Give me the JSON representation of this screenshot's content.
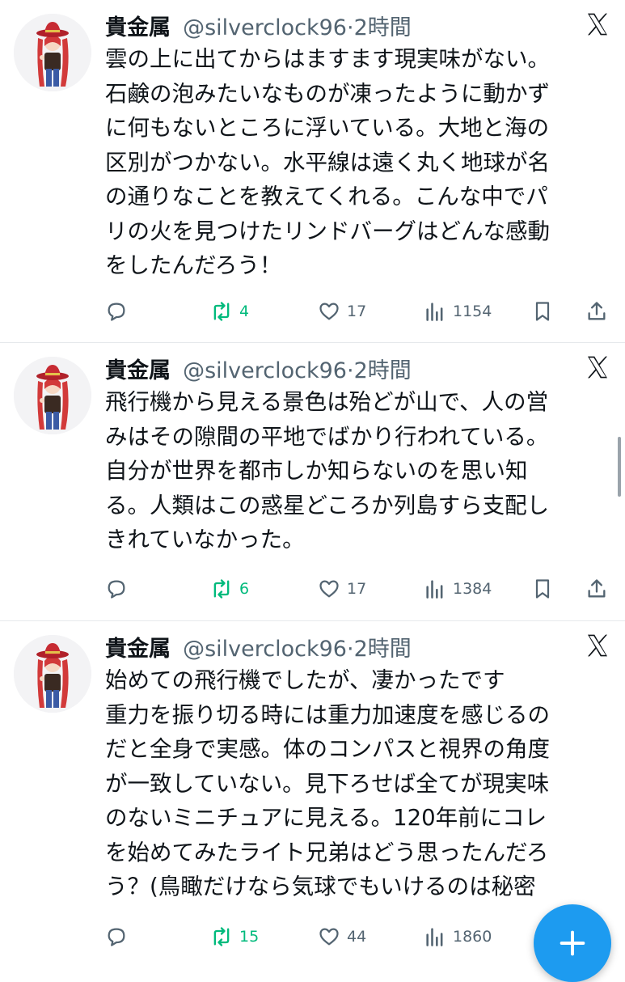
{
  "tweets": [
    {
      "author": "貴金属",
      "handle": "@silverclock96",
      "separator": "·",
      "time": "2時間",
      "lines": [
        "雲の上に出てからはますます現実味がない。",
        "石鹸の泡みたいなものが凍ったように動かず",
        "に何もないところに浮いている。大地と海の",
        "区別がつかない。水平線は遠く丸く地球が名",
        "の通りなことを教えてくれる。こんな中でパ",
        "リの火を見つけたリンドバーグはどんな感動",
        "をしたんだろう！"
      ],
      "reply_count": "",
      "retweets": "4",
      "likes": "17",
      "views": "1154"
    },
    {
      "author": "貴金属",
      "handle": "@silverclock96",
      "separator": "·",
      "time": "2時間",
      "lines": [
        "飛行機から見える景色は殆どが山で、人の営",
        "みはその隙間の平地でばかり行われている。",
        "自分が世界を都市しか知らないのを思い知",
        "る。人類はこの惑星どころか列島すら支配し",
        "きれていなかった。"
      ],
      "reply_count": "",
      "retweets": "6",
      "likes": "17",
      "views": "1384"
    },
    {
      "author": "貴金属",
      "handle": "@silverclock96",
      "separator": "·",
      "time": "2時間",
      "lines": [
        "始めての飛行機でしたが、凄かったです",
        "重力を振り切る時には重力加速度を感じるの",
        "だと全身で実感。体のコンパスと視界の角度",
        "が一致していない。見下ろせば全てが現実味",
        "のないミニチュアに見える。120年前にコレ",
        "を始めてみたライト兄弟はどう思ったんだろ",
        "う？(鳥瞰だけなら気球でもいけるのは秘密"
      ],
      "reply_count": "",
      "retweets": "15",
      "likes": "44",
      "views": "1860"
    }
  ],
  "icons": {
    "x_logo": "x-logo-icon",
    "reply": "reply-icon",
    "retweet": "retweet-icon",
    "like": "heart-icon",
    "views": "views-icon",
    "bookmark": "bookmark-icon",
    "share": "share-icon",
    "compose": "plus-icon"
  },
  "colors": {
    "text": "#0f1419",
    "secondary": "#536471",
    "retweet_green": "#00ba7c",
    "accent_blue": "#1d9bf0",
    "divider": "#e6e9ec"
  }
}
